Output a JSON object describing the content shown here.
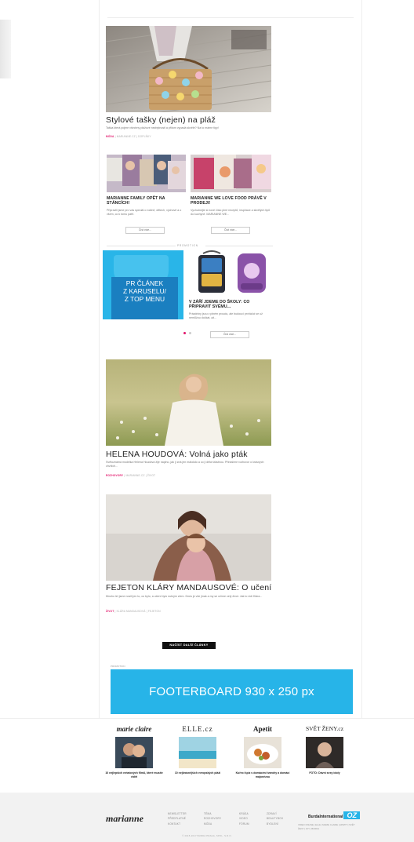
{
  "articles": {
    "hero": {
      "title": "Stylové tašky (nejen) na pláž",
      "perex": "Taška která pojme všechny plážové nezbytnosti a přitom vypadá skvěle? Na to máme tipy!",
      "category": "MÓDA",
      "author": "MARIANNE.CZ",
      "tag": "DOPLŇKY"
    },
    "left_card": {
      "title": "MARIANNE FAMILY OPĚT NA STÁNCÍCH!",
      "perex": "Připravili jsme pro vás speciál o rodině, dětech, výchově a o všem, co k tomu patří.",
      "button": "Číst více..."
    },
    "right_card": {
      "title": "MARIANNE WE LOVE FOOD PRÁVĚ V PRODEJI!",
      "perex": "Vychutnejte si nové číslo plné receptů, inspirace a skvělých tipů do kuchyně. MARIANNE WE...",
      "button": "Číst více..."
    },
    "promo_card": {
      "title": "V ZÁŘÍ JDEME DO ŠKOLY: CO PŘIPRAVIT SVÉMU...",
      "perex": "Prázdniny jsou v plném proudu, ale budoucí prvňáčci se už nemůžou dočkat, až...",
      "button": "Číst více..."
    },
    "second": {
      "title": "HELENA HOUDOVÁ: Volná jako pták",
      "perex": "Světoznámá modelka Helena Houdová žije naplno, jak ji zná jen málokdo a co ji dělá šťastnou. Přinášíme rozhovor o krásných chvílích...",
      "category": "ROZHOVORY",
      "author": "MARIANNE.CZ",
      "tag": "ŽIVOT"
    },
    "third": {
      "title": "FEJETON KLÁRY MANDAUSOVÉ: O učení",
      "perex": "Mnoho let jsme nosili jen to, co bylo, a učení bylo nutným zlem. Dnes je vše jinak a my se učíme celý život. Jak to vidí Klára...",
      "category": "ŽIVOT",
      "author": "KLÁRA MANDAUSOVÁ",
      "tag": "FEJETON"
    }
  },
  "promo": {
    "section_label": "PROMOTION",
    "pr_label_line1": "PR ČLÁNEK",
    "pr_label_line2": "Z KARUSELU/",
    "pr_label_line3": "Z TOP MENU"
  },
  "load_more": "NAČÍST DALŠÍ ČLÁNKY",
  "footerboard": {
    "label": "PROMOTION",
    "text": "FOOTERBOARD 930 x 250 px"
  },
  "partners": [
    {
      "logo": "marie claire",
      "caption": "10 nejlepších netatových filmů, které musíte vidět"
    },
    {
      "logo": "ELLE.cz",
      "caption": "10 nejkrásnějších evropských pláží"
    },
    {
      "logo": "Apetit",
      "caption": "Kuřecí špíz s domácími tvarohy a domácí majonézou"
    },
    {
      "logo": "SVĚT ŽENY.cz",
      "caption": "FOTO: Dávní sexy idoly"
    }
  ],
  "footer": {
    "brand": "marianne",
    "col1": [
      "NEWSLETTER",
      "PŘEDPLATNÉ",
      "KONTAKT"
    ],
    "col2": [
      "TÉMA",
      "ROZHOVORY",
      "MÓDA"
    ],
    "col3": [
      "KRÁSA",
      "VIDEO",
      "FÓRUM"
    ],
    "col4": [
      "ZDRAVÍ",
      "BEAUTYBOX",
      "BYDLENÍ"
    ],
    "burda_text": "BurdaInternational",
    "burda_oz": "OZ",
    "burda_links": "VIDEO ONLINE | ELLE | MARIE CLAIRE | APETIT | SVĚT ŽENY | JOY | BURDA",
    "copyright": "© 2015-2017 BURDA PRAHA, SPOL. S.R.O."
  },
  "colors": {
    "accent_pink": "#e2156b",
    "promo_blue": "#27b4e8",
    "pr_blue": "#1a7fc0"
  }
}
